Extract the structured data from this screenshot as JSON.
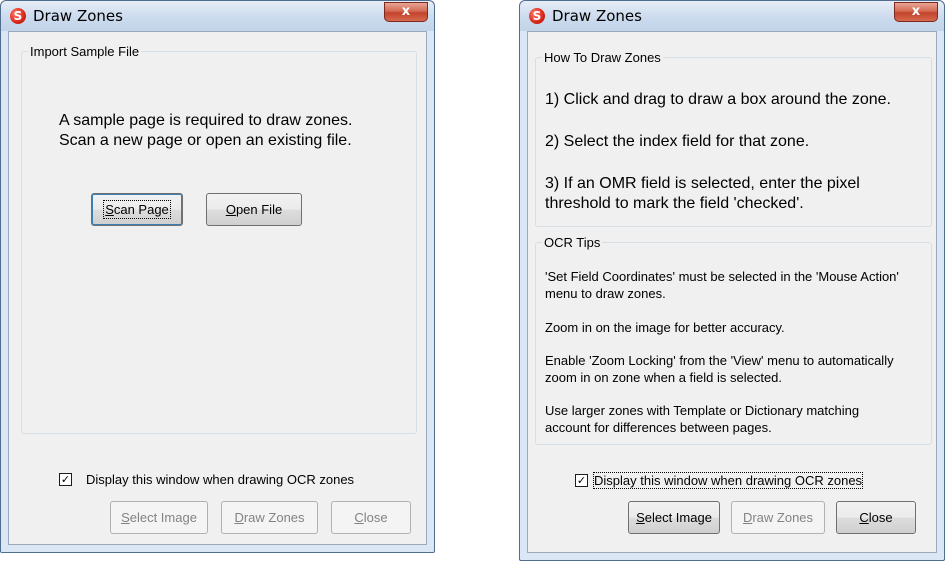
{
  "left_window": {
    "title": "Draw Zones",
    "close_glyph": "x",
    "group_title": "Import Sample File",
    "message_line1": "A sample page is required to draw zones.",
    "message_line2": "Scan a new page or open an existing file.",
    "scan_button": {
      "mnemonic": "S",
      "rest": "can Page"
    },
    "open_button": {
      "mnemonic": "O",
      "rest": "pen File"
    },
    "checkbox_label": "Display this window when drawing OCR zones",
    "checkbox_checked": true,
    "select_image_button": {
      "mnemonic": "S",
      "rest": "elect Image"
    },
    "draw_zones_button": {
      "mnemonic": "D",
      "rest": "raw Zones"
    },
    "close_button": {
      "mnemonic": "C",
      "rest": "lose"
    }
  },
  "right_window": {
    "title": "Draw Zones",
    "close_glyph": "x",
    "howto_title": "How To Draw Zones",
    "steps": [
      "1) Click and drag to draw a box around the zone.",
      "2) Select the index field for that zone.",
      "3) If an OMR field is selected, enter the pixel",
      "threshold to mark the field 'checked'."
    ],
    "tips_title": "OCR Tips",
    "tips": [
      "'Set Field Coordinates' must be selected in the 'Mouse Action'",
      "menu to draw zones.",
      "Zoom in on the image for better accuracy.",
      "Enable 'Zoom Locking' from the 'View' menu to automatically",
      "zoom in on zone when a field is selected.",
      "Use larger zones with Template or Dictionary matching",
      "account for differences between pages."
    ],
    "checkbox_label": "Display this window when drawing OCR zones",
    "checkbox_checked": true,
    "select_image_button": {
      "mnemonic": "S",
      "rest": "elect Image"
    },
    "draw_zones_button": {
      "mnemonic": "D",
      "rest": "raw Zones"
    },
    "close_button": {
      "mnemonic": "C",
      "rest": "lose"
    }
  },
  "icons": {
    "app": "app-logo-icon",
    "check": "checkmark-icon",
    "close": "close-icon"
  },
  "colors": {
    "frame": "#dbe7f4",
    "client": "#f0f0f0",
    "close_button": "#c2432a"
  }
}
